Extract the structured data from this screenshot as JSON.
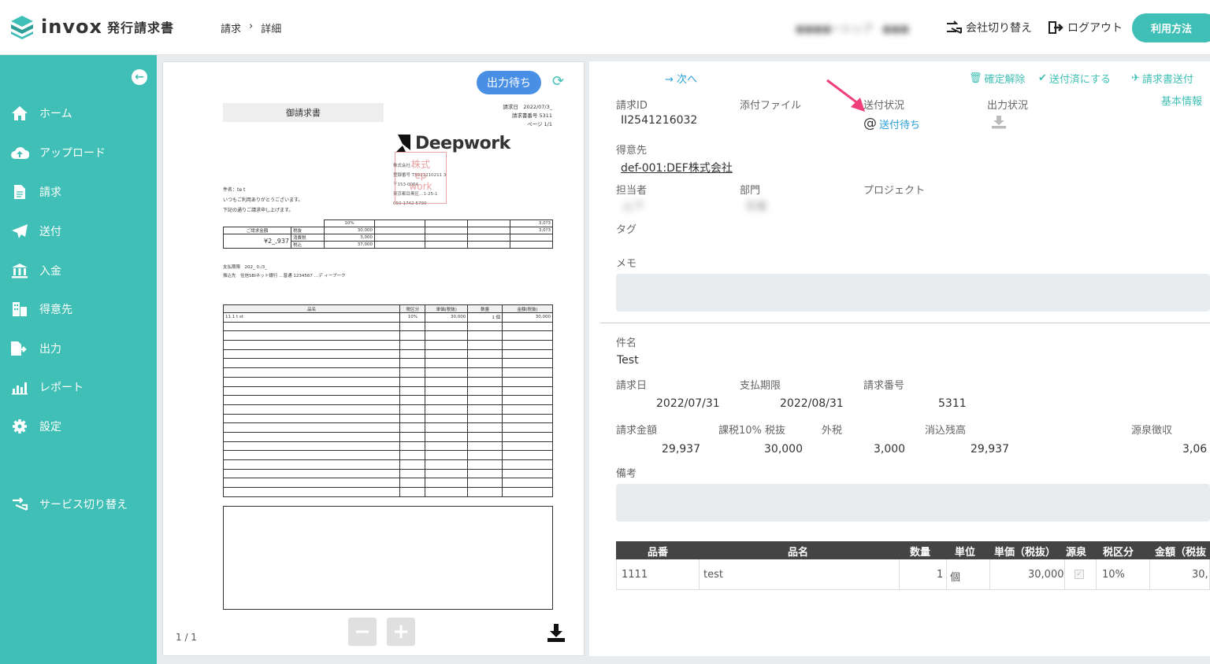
{
  "header": {
    "brand": "invox",
    "brand_sub": "発行請求書",
    "breadcrumb": [
      "請求",
      "詳細"
    ],
    "user_name": "●●●●ーシップ　●●●",
    "switch_company": "会社切り替え",
    "logout": "ログアウト",
    "help": "利用方法"
  },
  "sidebar": {
    "items": [
      {
        "label": "ホーム",
        "icon": "home-icon"
      },
      {
        "label": "アップロード",
        "icon": "cloud-upload-icon"
      },
      {
        "label": "請求",
        "icon": "document-icon"
      },
      {
        "label": "送付",
        "icon": "paper-plane-icon"
      },
      {
        "label": "入金",
        "icon": "bank-icon"
      },
      {
        "label": "得意先",
        "icon": "building-icon"
      },
      {
        "label": "出力",
        "icon": "file-export-icon"
      },
      {
        "label": "レポート",
        "icon": "chart-icon"
      },
      {
        "label": "設定",
        "icon": "gear-icon"
      }
    ],
    "service_switch": "サービス切り替え"
  },
  "preview": {
    "status": "出力待ち",
    "page_count": "1 / 1",
    "doc": {
      "title": "御請求書",
      "meta": [
        "請求日　2022/07/3_",
        "請求書番号 5311",
        "ページ 1/1"
      ],
      "company": "Deepwork",
      "greeting": [
        "件名：te t",
        "いつもご利用ありがとうございます。",
        "下記の通りご請求申し上げます。"
      ],
      "address": [
        "株式会社…",
        "登録番号 T5011210211 3",
        "〒153-0064",
        "東京都目黒区…1-25-1",
        "050-1742-5790"
      ],
      "total_label": "ご請求金額",
      "total_value": "¥2_,937",
      "tax_rate": "10%",
      "rows_small": [
        [
          "税抜",
          "30,000"
        ],
        [
          "消費税",
          "3,000"
        ],
        [
          "税込",
          "37,000"
        ]
      ],
      "withholding": "3,0?3",
      "withholding2": "3,0?3",
      "pay_due": "支払期限　202_ 0./3_",
      "pay_to": "振込先　住信SBIネット銀行 …普通 1234567 …デ ィープーク",
      "item_headers": [
        "品名",
        "税区分",
        "単価(税抜)",
        "数量",
        "金額(税抜)"
      ],
      "item_row": [
        "11.1 t st",
        "10%",
        "30,000",
        "1 個",
        "30,000"
      ]
    }
  },
  "detail": {
    "next": "次へ",
    "actions": [
      "確定解除",
      "送付済にする",
      "請求書送付"
    ],
    "basic_info": "基本情報",
    "invoice_id_label": "請求ID",
    "invoice_id": "II2541216032",
    "attachment_label": "添付ファイル",
    "send_status_label": "送付状況",
    "send_status": "送付待ち",
    "output_status_label": "出力状況",
    "customer_label": "得意先",
    "customer": "def-001:DEF株式会社",
    "person_label": "担当者",
    "person": "山下",
    "dept_label": "部門",
    "dept": "営業",
    "project_label": "プロジェクト",
    "tag_label": "タグ",
    "memo_label": "メモ",
    "subject_label": "件名",
    "subject": "Test",
    "invoice_date_label": "請求日",
    "invoice_date": "2022/07/31",
    "due_label": "支払期限",
    "due": "2022/08/31",
    "number_label": "請求番号",
    "number": "5311",
    "amount_label": "請求金額",
    "amount": "29,937",
    "taxable_label": "課税10% 税抜",
    "taxable": "30,000",
    "external_tax_label": "外税",
    "external_tax": "3,000",
    "balance_label": "消込残高",
    "balance": "29,937",
    "withholding_label": "源泉徴収",
    "withholding": "3,06",
    "remarks_label": "備考",
    "items": {
      "headers": [
        "品番",
        "品名",
        "数量",
        "単位",
        "単価（税抜）",
        "源泉",
        "税区分",
        "金額（税抜"
      ],
      "row": [
        "1111",
        "test",
        "1",
        "個",
        "30,000",
        "",
        "10%",
        "30,"
      ]
    }
  },
  "colors": {
    "brand": "#3fbfb5",
    "status_blue": "#4a8fe6",
    "link_blue": "#2a9fd8",
    "annotation": "#f0407a"
  }
}
